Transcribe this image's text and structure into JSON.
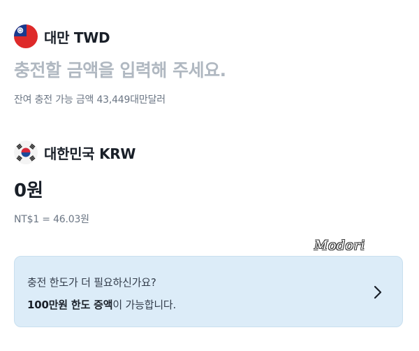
{
  "source": {
    "flag_icon": "taiwan-flag-icon",
    "currency_name": "대만 TWD",
    "amount_placeholder": "충전할 금액을 입력해 주세요.",
    "balance_text": "잔여 충전 가능 금액 43,449대만달러"
  },
  "target": {
    "flag_icon": "korea-flag-icon",
    "currency_name": "대한민국 KRW",
    "amount": "0원",
    "exchange_rate": "NT$1 = 46.03원"
  },
  "watermark": "Modori",
  "limit_card": {
    "line1": "충전 한도가 더 필요하신가요?",
    "line2_bold": "100만원 한도 증액",
    "line2_rest": "이 가능합니다.",
    "chevron_icon": "chevron-right-icon"
  },
  "colors": {
    "card_background": "#dcecf8",
    "placeholder": "#b0b8c1",
    "secondary_text": "#6b7684",
    "primary_text": "#191f28"
  }
}
